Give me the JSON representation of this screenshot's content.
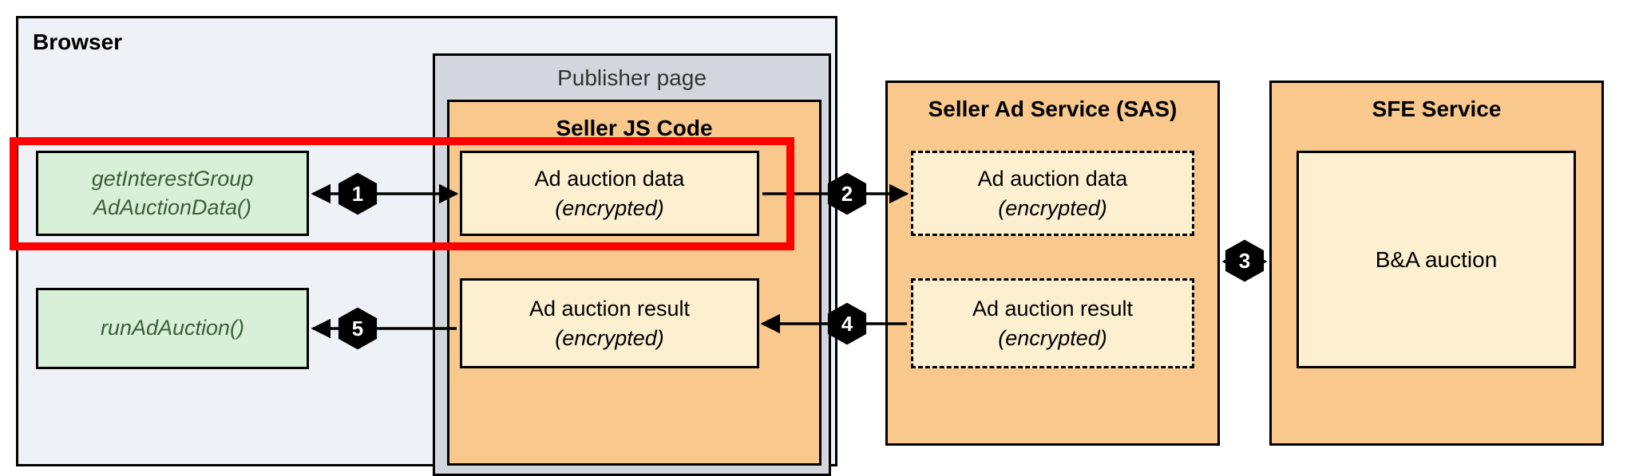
{
  "browser": {
    "title": "Browser"
  },
  "publisher": {
    "title": "Publisher page"
  },
  "seller_js": {
    "title": "Seller JS Code",
    "data_box": {
      "line1": "Ad auction data",
      "line2": "(encrypted)"
    },
    "result_box": {
      "line1": "Ad auction result",
      "line2": "(encrypted)"
    }
  },
  "apis": {
    "getInterestGroup": {
      "line1": "getInterestGroup",
      "line2": "AdAuctionData()"
    },
    "runAdAuction": "runAdAuction()"
  },
  "sas": {
    "title": "Seller Ad Service (SAS)",
    "data_box": {
      "line1": "Ad auction data",
      "line2": "(encrypted)"
    },
    "result_box": {
      "line1": "Ad auction result",
      "line2": "(encrypted)"
    }
  },
  "sfe": {
    "title": "SFE Service",
    "ba_box": "B&A auction"
  },
  "steps": {
    "s1": "1",
    "s2": "2",
    "s3": "3",
    "s4": "4",
    "s5": "5"
  }
}
